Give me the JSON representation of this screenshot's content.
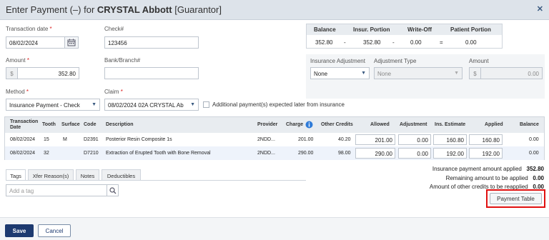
{
  "dialog": {
    "title_prefix": "Enter Payment (–) for ",
    "title_name": "CRYSTAL Abbott",
    "title_suffix": " [Guarantor]",
    "close_icon": "close-icon"
  },
  "form": {
    "transaction_date_label": "Transaction date",
    "transaction_date_value": "08/02/2024",
    "check_label": "Check#",
    "check_value": "123456",
    "amount_label": "Amount",
    "amount_addon": "$",
    "amount_value": "352.80",
    "bank_label": "Bank/Branch#",
    "bank_value": "",
    "method_label": "Method",
    "method_value": "Insurance Payment - Check",
    "claim_label": "Claim",
    "claim_value": "08/02/2024 02A CRYSTAL Ab",
    "additional_label": "Additional payment(s) expected later from insurance",
    "required_mark": "*"
  },
  "balance": {
    "headers": [
      "Balance",
      "Insur. Portion",
      "Write-Off",
      "Patient Portion"
    ],
    "balance": "352.80",
    "op1": "-",
    "insur": "352.80",
    "op2": "-",
    "writeoff": "0.00",
    "op3": "=",
    "patient": "0.00"
  },
  "insurance_adj": {
    "adj_label": "Insurance Adjustment",
    "adj_value": "None",
    "type_label": "Adjustment Type",
    "type_value": "None",
    "amount_label": "Amount",
    "amount_addon": "$",
    "amount_value": "0.00"
  },
  "grid": {
    "headers": {
      "date_line1": "Transaction",
      "date_line2": "Date",
      "tooth": "Tooth",
      "surface": "Surface",
      "code": "Code",
      "description": "Description",
      "provider": "Provider",
      "charge": "Charge",
      "other_credits": "Other Credits",
      "allowed": "Allowed",
      "adjustment": "Adjustment",
      "ins_estimate": "Ins. Estimate",
      "applied": "Applied",
      "balance": "Balance"
    },
    "rows": [
      {
        "date": "08/02/2024",
        "tooth": "15",
        "surface": "M",
        "code": "D2391",
        "description": "Posterior Resin Composite 1s",
        "provider": "2NDD...",
        "charge": "201.00",
        "other_credits": "40.20",
        "allowed": "201.00",
        "adjustment": "0.00",
        "ins_estimate": "160.80",
        "applied": "160.80",
        "balance": "0.00"
      },
      {
        "date": "08/02/2024",
        "tooth": "32",
        "surface": "",
        "code": "D7210",
        "description": "Extraction of Erupted Tooth with Bone Removal",
        "provider": "2NDD...",
        "charge": "290.00",
        "other_credits": "98.00",
        "allowed": "290.00",
        "adjustment": "0.00",
        "ins_estimate": "192.00",
        "applied": "192.00",
        "balance": "0.00"
      }
    ]
  },
  "tabs": {
    "tags": "Tags",
    "xfer": "Xfer Reason(s)",
    "notes": "Notes",
    "deductibles": "Deductibles",
    "tag_placeholder": "Add a tag"
  },
  "summary": {
    "applied_label": "Insurance payment amount applied",
    "applied_value": "352.80",
    "remaining_label": "Remaining amount to be applied",
    "remaining_value": "0.00",
    "reapplied_label": "Amount of other credits to be reapplied",
    "reapplied_value": "0.00"
  },
  "buttons": {
    "payment_table": "Payment Table",
    "save": "Save",
    "cancel": "Cancel"
  }
}
